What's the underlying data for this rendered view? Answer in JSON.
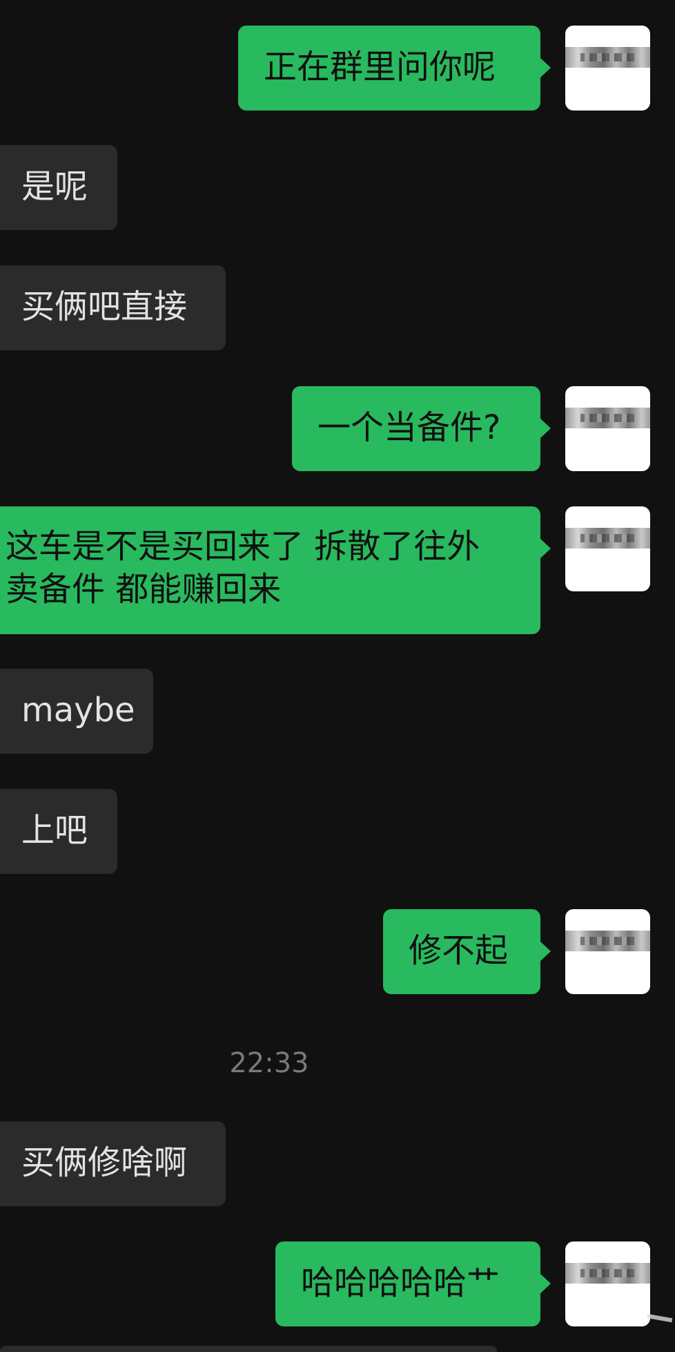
{
  "messages": [
    {
      "direction": "sent",
      "lines": [
        "正在群里问你呢"
      ]
    },
    {
      "direction": "received",
      "lines": [
        "是呢"
      ]
    },
    {
      "direction": "received",
      "lines": [
        "买俩吧直接"
      ]
    },
    {
      "direction": "sent",
      "lines": [
        "一个当备件?"
      ]
    },
    {
      "direction": "sent",
      "lines": [
        "这车是不是买回来了 拆散了往外",
        "卖备件 都能赚回来"
      ]
    },
    {
      "direction": "received",
      "lines": [
        "maybe"
      ]
    },
    {
      "direction": "received",
      "lines": [
        "上吧"
      ]
    },
    {
      "direction": "sent",
      "lines": [
        "修不起"
      ]
    },
    {
      "direction": "received",
      "lines": [
        "买俩修啥啊"
      ]
    },
    {
      "direction": "sent",
      "lines": [
        "哈哈哈哈哈艹"
      ]
    }
  ],
  "timestamp": "22:33",
  "colors": {
    "background": "#111111",
    "sent_bubble": "#29b95e",
    "received_bubble": "#2b2b2b",
    "received_text": "#e3e3e3",
    "timestamp_text": "#7a7a7a"
  },
  "avatar_icon": "user-avatar-icon"
}
